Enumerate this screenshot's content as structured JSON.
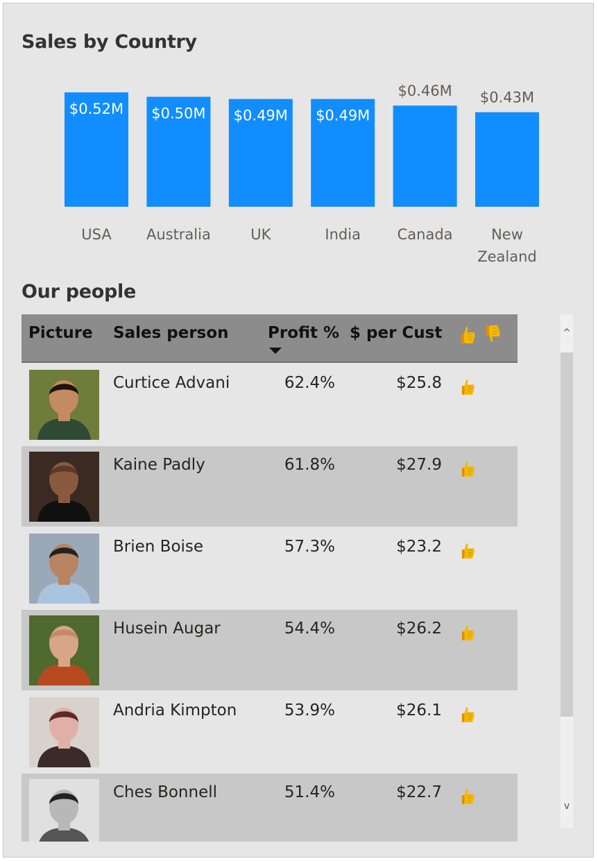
{
  "chart_title": "Sales by Country",
  "chart_data": {
    "type": "bar",
    "title": "Sales by Country",
    "categories": [
      "USA",
      "Australia",
      "UK",
      "India",
      "Canada",
      "New Zealand"
    ],
    "values": [
      0.52,
      0.5,
      0.49,
      0.49,
      0.46,
      0.43
    ],
    "data_labels": [
      "$0.52M",
      "$0.50M",
      "$0.49M",
      "$0.49M",
      "$0.46M",
      "$0.43M"
    ],
    "unit": "$M",
    "color": "#118dff",
    "grid": false,
    "legend": "none"
  },
  "table": {
    "title": "Our people",
    "columns": {
      "picture": "Picture",
      "sales_person": "Sales person",
      "profit": "Profit %",
      "per_cust": "$ per Cust",
      "kpi_up_icon": "thumbs-up-icon",
      "kpi_down_icon": "thumbs-down-icon"
    },
    "sort": {
      "column": "Profit %",
      "direction": "descending"
    },
    "rows": [
      {
        "name": "Curtice Advani",
        "profit": "62.4%",
        "per_cust": "$25.8",
        "kpi": "thumbs-up-icon"
      },
      {
        "name": "Kaine Padly",
        "profit": "61.8%",
        "per_cust": "$27.9",
        "kpi": "thumbs-up-icon"
      },
      {
        "name": "Brien Boise",
        "profit": "57.3%",
        "per_cust": "$23.2",
        "kpi": "thumbs-up-icon"
      },
      {
        "name": "Husein Augar",
        "profit": "54.4%",
        "per_cust": "$26.2",
        "kpi": "thumbs-up-icon"
      },
      {
        "name": "Andria Kimpton",
        "profit": "53.9%",
        "per_cust": "$26.1",
        "kpi": "thumbs-up-icon"
      },
      {
        "name": "Ches Bonnell",
        "profit": "51.4%",
        "per_cust": "$22.7",
        "kpi": "thumbs-up-icon"
      }
    ]
  },
  "colors": {
    "thumb": "#f5b800",
    "header_bg": "#8c8c8c",
    "alt_row": "#c8c8c8"
  }
}
